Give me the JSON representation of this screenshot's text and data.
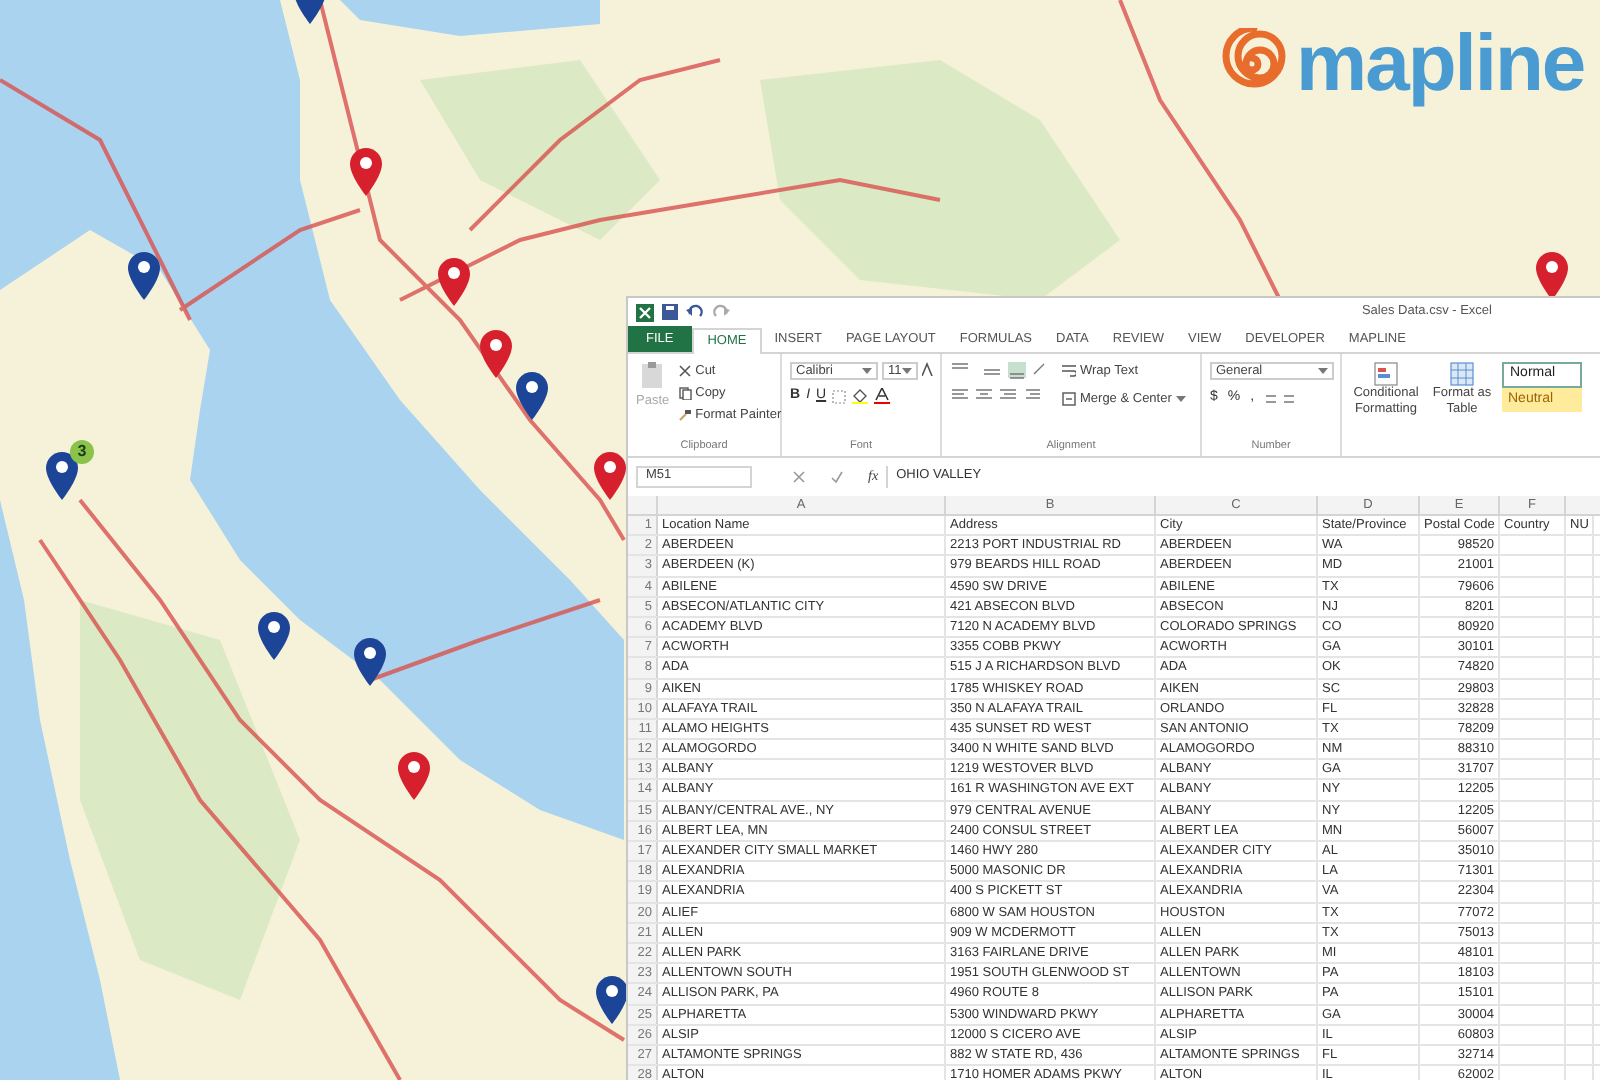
{
  "map": {
    "pins": [
      {
        "color": "#1c4597"
      },
      {
        "color": "#d7202e"
      },
      {
        "color": "#d7202e"
      },
      {
        "color": "#d7202e"
      },
      {
        "color": "#1c4597"
      },
      {
        "color": "#d7202e"
      },
      {
        "color": "#1c4597"
      },
      {
        "color": "#1c4597"
      },
      {
        "color": "#1c4597"
      },
      {
        "color": "#1c4597"
      },
      {
        "color": "#d7202e"
      },
      {
        "color": "#1c4597"
      },
      {
        "color": "#d7202e"
      }
    ],
    "cluster_badge": "3"
  },
  "logo": {
    "text": "mapline"
  },
  "excel": {
    "title": "Sales Data.csv - Excel",
    "tabs": [
      {
        "label": "FILE",
        "kind": "file",
        "selected": false
      },
      {
        "label": "HOME",
        "kind": "tab",
        "selected": true
      },
      {
        "label": "INSERT",
        "kind": "tab",
        "selected": false
      },
      {
        "label": "PAGE LAYOUT",
        "kind": "tab",
        "selected": false
      },
      {
        "label": "FORMULAS",
        "kind": "tab",
        "selected": false
      },
      {
        "label": "DATA",
        "kind": "tab",
        "selected": false
      },
      {
        "label": "REVIEW",
        "kind": "tab",
        "selected": false
      },
      {
        "label": "VIEW",
        "kind": "tab",
        "selected": false
      },
      {
        "label": "DEVELOPER",
        "kind": "tab",
        "selected": false
      },
      {
        "label": "MAPLINE",
        "kind": "tab",
        "selected": false
      }
    ],
    "ribbon": {
      "clipboard": {
        "paste": "Paste",
        "paste_disabled": true,
        "cut": "Cut",
        "copy": "Copy",
        "format_painter": "Format Painter",
        "label": "Clipboard"
      },
      "font": {
        "name": "Calibri",
        "size": "11",
        "bold": "B",
        "italic": "I",
        "underline": "U",
        "label": "Font"
      },
      "alignment": {
        "wrap_text": "Wrap Text",
        "merge_center": "Merge & Center",
        "label": "Alignment"
      },
      "number": {
        "format": "General",
        "currency": "$",
        "percent": "%",
        "comma": ",",
        "label": "Number"
      },
      "styles": {
        "conditional_formatting": "Conditional Formatting",
        "format_as_table": "Format as Table",
        "normal": "Normal",
        "neutral": "Neutral"
      }
    },
    "formula_bar": {
      "name_box": "M51",
      "fx": "fx",
      "value": "OHIO VALLEY"
    },
    "sheet": {
      "columns": [
        "A",
        "B",
        "C",
        "D",
        "E",
        "F"
      ],
      "rows": [
        {
          "number": "1",
          "cells": [
            "Location Name",
            "Address",
            "City",
            "State/Province",
            "Postal Code",
            "Country",
            "NU"
          ]
        },
        {
          "number": "2",
          "cells": [
            "ABERDEEN",
            "2213 PORT INDUSTRIAL RD",
            "ABERDEEN",
            "WA",
            "98520"
          ]
        },
        {
          "number": "3",
          "cells": [
            "ABERDEEN (K)",
            "979 BEARDS HILL ROAD",
            "ABERDEEN",
            "MD",
            "21001"
          ]
        },
        {
          "number": "4",
          "cells": [
            "ABILENE",
            "4590 SW DRIVE",
            "ABILENE",
            "TX",
            "79606"
          ]
        },
        {
          "number": "5",
          "cells": [
            "ABSECON/ATLANTIC CITY",
            "421 ABSECON BLVD",
            "ABSECON",
            "NJ",
            "8201"
          ]
        },
        {
          "number": "6",
          "cells": [
            "ACADEMY BLVD",
            "7120 N ACADEMY BLVD",
            "COLORADO SPRINGS",
            "CO",
            "80920"
          ]
        },
        {
          "number": "7",
          "cells": [
            "ACWORTH",
            "3355 COBB PKWY",
            "ACWORTH",
            "GA",
            "30101"
          ]
        },
        {
          "number": "8",
          "cells": [
            "ADA",
            "515 J A RICHARDSON BLVD",
            "ADA",
            "OK",
            "74820"
          ]
        },
        {
          "number": "9",
          "cells": [
            "AIKEN",
            "1785 WHISKEY ROAD",
            "AIKEN",
            "SC",
            "29803"
          ]
        },
        {
          "number": "10",
          "cells": [
            "ALAFAYA TRAIL",
            "350 N ALAFAYA TRAIL",
            "ORLANDO",
            "FL",
            "32828"
          ]
        },
        {
          "number": "11",
          "cells": [
            "ALAMO HEIGHTS",
            "435 SUNSET RD WEST",
            "SAN ANTONIO",
            "TX",
            "78209"
          ]
        },
        {
          "number": "12",
          "cells": [
            "ALAMOGORDO",
            "3400 N WHITE SAND BLVD",
            "ALAMOGORDO",
            "NM",
            "88310"
          ]
        },
        {
          "number": "13",
          "cells": [
            "ALBANY",
            "1219 WESTOVER BLVD",
            "ALBANY",
            "GA",
            "31707"
          ]
        },
        {
          "number": "14",
          "cells": [
            "ALBANY",
            "161 R WASHINGTON AVE EXT",
            "ALBANY",
            "NY",
            "12205"
          ]
        },
        {
          "number": "15",
          "cells": [
            "ALBANY/CENTRAL AVE., NY",
            "979 CENTRAL AVENUE",
            "ALBANY",
            "NY",
            "12205"
          ]
        },
        {
          "number": "16",
          "cells": [
            "ALBERT LEA, MN",
            "2400 CONSUL STREET",
            "ALBERT LEA",
            "MN",
            "56007"
          ]
        },
        {
          "number": "17",
          "cells": [
            "ALEXANDER CITY SMALL MARKET",
            "1460 HWY 280",
            "ALEXANDER CITY",
            "AL",
            "35010"
          ]
        },
        {
          "number": "18",
          "cells": [
            "ALEXANDRIA",
            "5000 MASONIC DR",
            "ALEXANDRIA",
            "LA",
            "71301"
          ]
        },
        {
          "number": "19",
          "cells": [
            "ALEXANDRIA",
            "400 S PICKETT ST",
            "ALEXANDRIA",
            "VA",
            "22304"
          ]
        },
        {
          "number": "20",
          "cells": [
            "ALIEF",
            "6800 W SAM HOUSTON",
            "HOUSTON",
            "TX",
            "77072"
          ]
        },
        {
          "number": "21",
          "cells": [
            "ALLEN",
            "909 W MCDERMOTT",
            "ALLEN",
            "TX",
            "75013"
          ]
        },
        {
          "number": "22",
          "cells": [
            "ALLEN PARK",
            "3163 FAIRLANE DRIVE",
            "ALLEN PARK",
            "MI",
            "48101"
          ]
        },
        {
          "number": "23",
          "cells": [
            "ALLENTOWN SOUTH",
            "1951 SOUTH GLENWOOD ST",
            "ALLENTOWN",
            "PA",
            "18103"
          ]
        },
        {
          "number": "24",
          "cells": [
            "ALLISON PARK, PA",
            "4960 ROUTE 8",
            "ALLISON PARK",
            "PA",
            "15101"
          ]
        },
        {
          "number": "25",
          "cells": [
            "ALPHARETTA",
            "5300 WINDWARD PKWY",
            "ALPHARETTA",
            "GA",
            "30004"
          ]
        },
        {
          "number": "26",
          "cells": [
            "ALSIP",
            "12000 S CICERO AVE",
            "ALSIP",
            "IL",
            "60803"
          ]
        },
        {
          "number": "27",
          "cells": [
            "ALTAMONTE SPRINGS",
            "882 W STATE RD, 436",
            "ALTAMONTE SPRINGS",
            "FL",
            "32714"
          ]
        },
        {
          "number": "28",
          "cells": [
            "ALTON",
            "1710 HOMER ADAMS PKWY",
            "ALTON",
            "IL",
            "62002"
          ]
        }
      ]
    }
  }
}
